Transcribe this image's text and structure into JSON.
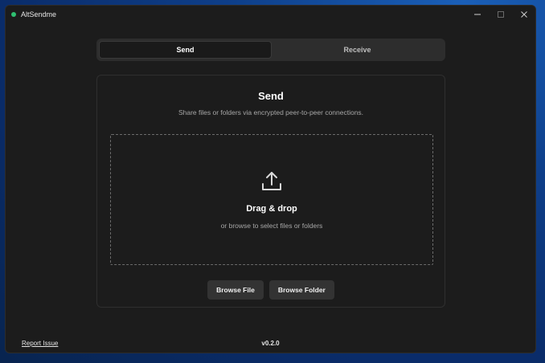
{
  "window": {
    "title": "AltSendme",
    "accent": "#2fbf71"
  },
  "tabs": [
    {
      "label": "Send",
      "active": true
    },
    {
      "label": "Receive",
      "active": false
    }
  ],
  "send": {
    "title": "Send",
    "subtitle": "Share files or folders via encrypted peer-to-peer connections.",
    "dropzone": {
      "icon": "upload-icon",
      "title": "Drag & drop",
      "subtitle": "or browse to select files or folders"
    },
    "buttons": {
      "browse_file": "Browse File",
      "browse_folder": "Browse Folder"
    }
  },
  "footer": {
    "report_issue": "Report Issue",
    "version": "v0.2.0"
  }
}
